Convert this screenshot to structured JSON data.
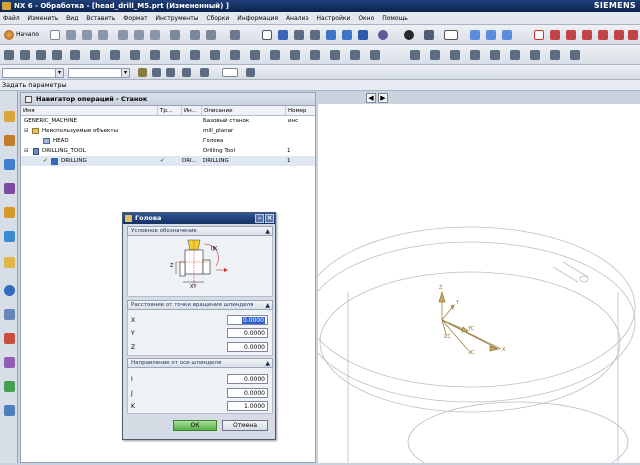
{
  "window": {
    "title": "NX 6 - Обработка - [head_drill_M5.prt (Измененный) ]",
    "brand": "SIEMENS"
  },
  "menu": [
    "Файл",
    "Изменить",
    "Вид",
    "Вставить",
    "Формат",
    "Инструменты",
    "Сборки",
    "Информация",
    "Анализ",
    "Настройки",
    "Окно",
    "Помощь"
  ],
  "toolbar": {
    "start_label": "Начало"
  },
  "params_bar": {
    "label": "Задать параметры"
  },
  "navigator": {
    "title": "Навигатор операций - Станок",
    "columns": [
      "Имя",
      "Тр...",
      "Ин...",
      "Описание",
      "Номер инс"
    ],
    "rows": [
      {
        "name": "GENERIC_MACHINE",
        "tr": "",
        "in": "",
        "desc": "Базовый станок",
        "num": ""
      },
      {
        "name": "Неиспользуемые объекты",
        "tr": "",
        "in": "",
        "desc": "mill_planar",
        "num": ""
      },
      {
        "name": "HEAD",
        "tr": "",
        "in": "",
        "desc": "Голова",
        "num": ""
      },
      {
        "name": "DRILLING_TOOL",
        "tr": "",
        "in": "",
        "desc": "Drilling Tool",
        "num": "1"
      },
      {
        "name": "DRILLING",
        "tr": "✔",
        "in": "DRI...",
        "desc": "DRILLING",
        "num": "1"
      }
    ]
  },
  "dialog": {
    "title": "Голова",
    "sec_symbol": "Условное обозначение",
    "sec_distance": "Расстояние от точки вращения шпинделя",
    "sec_direction": "Направление от оси шпинделя",
    "fields_distance": [
      {
        "label": "X",
        "value": "0.0000"
      },
      {
        "label": "Y",
        "value": "0.0000"
      },
      {
        "label": "Z",
        "value": "0.0000"
      }
    ],
    "fields_direction": [
      {
        "label": "I",
        "value": "0.0000"
      },
      {
        "label": "J",
        "value": "0.0000"
      },
      {
        "label": "K",
        "value": "1.0000"
      }
    ],
    "ok": "ОК",
    "cancel": "Отмена",
    "diagram": {
      "z": "Z",
      "xy": "XY",
      "ik": "IJK"
    }
  },
  "triad": {
    "x": "X",
    "y": "Y",
    "z": "Z",
    "yc": "YC",
    "zc": "ZC",
    "xc": "XC"
  }
}
